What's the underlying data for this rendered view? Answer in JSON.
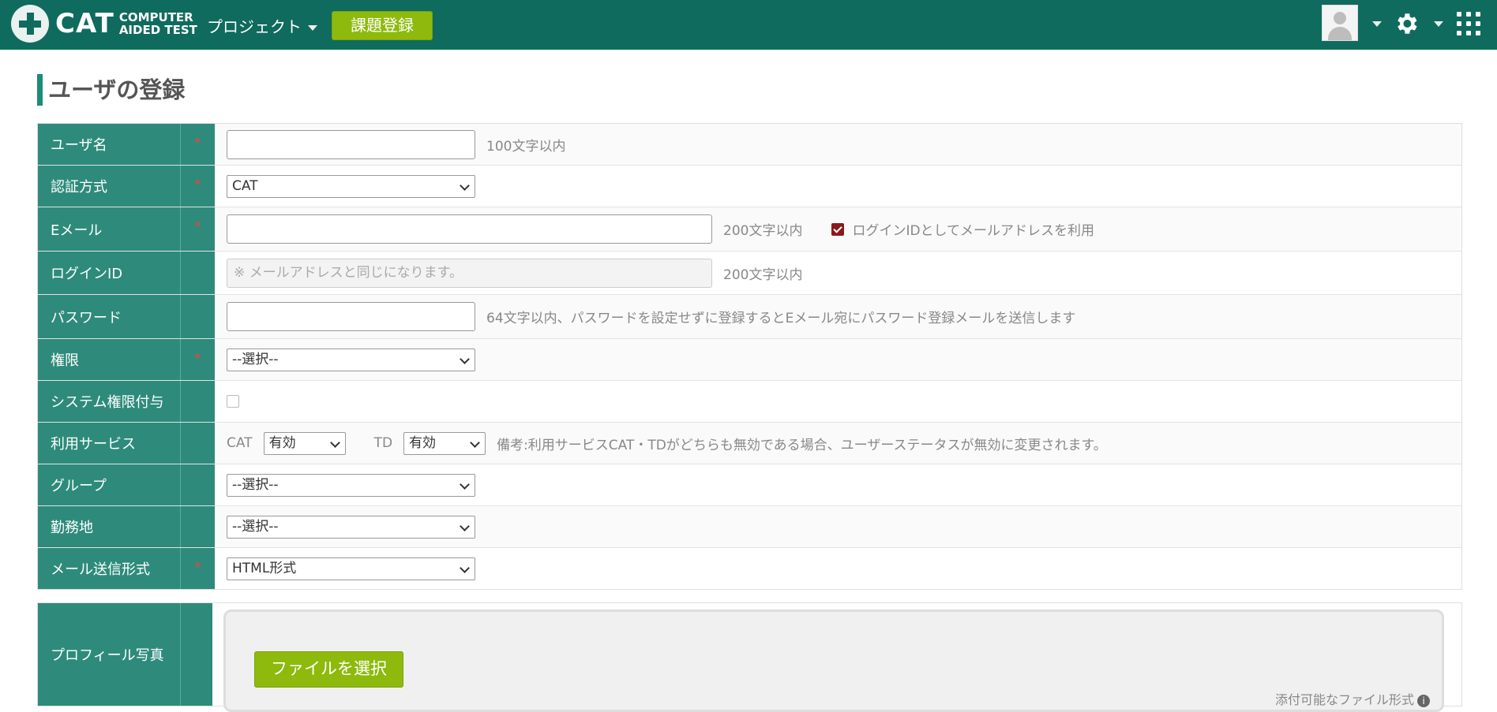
{
  "header": {
    "logo_main": "CAT",
    "logo_sub_1": "COMPUTER",
    "logo_sub_2": "AIDED TEST",
    "project_menu": "プロジェクト",
    "issue_button": "課題登録"
  },
  "page": {
    "title": "ユーザの登録"
  },
  "form": {
    "required_mark": "*",
    "username": {
      "label": "ユーザ名",
      "hint": "100文字以内",
      "value": ""
    },
    "auth": {
      "label": "認証方式",
      "selected": "CAT"
    },
    "email": {
      "label": "Eメール",
      "hint": "200文字以内",
      "checkbox_label": "ログインIDとしてメールアドレスを利用",
      "checked": true,
      "value": ""
    },
    "login_id": {
      "label": "ログインID",
      "placeholder": "※ メールアドレスと同じになります。",
      "hint": "200文字以内"
    },
    "password": {
      "label": "パスワード",
      "hint": "64文字以内、パスワードを設定せずに登録するとEメール宛にパスワード登録メールを送信します",
      "value": ""
    },
    "role": {
      "label": "権限",
      "selected": "--選択--"
    },
    "system_role": {
      "label": "システム権限付与",
      "checked": false
    },
    "services": {
      "label": "利用サービス",
      "cat_label": "CAT",
      "cat_selected": "有効",
      "td_label": "TD",
      "td_selected": "有効",
      "note": "備考:利用サービスCAT・TDがどちらも無効である場合、ユーザーステータスが無効に変更されます。"
    },
    "group": {
      "label": "グループ",
      "selected": "--選択--"
    },
    "workplace": {
      "label": "勤務地",
      "selected": "--選択--"
    },
    "mail_format": {
      "label": "メール送信形式",
      "selected": "HTML形式"
    }
  },
  "profile": {
    "label": "プロフィール写真",
    "file_button": "ファイルを選択",
    "file_note": "添付可能なファイル形式"
  }
}
